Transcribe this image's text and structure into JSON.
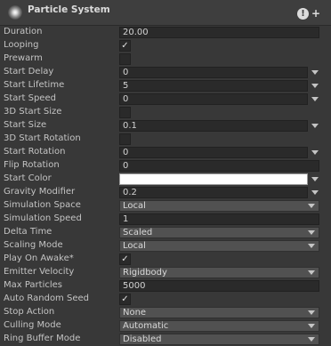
{
  "header": {
    "title": "Particle System",
    "icon": "particle-system-icon",
    "help_glyph": "!",
    "add_glyph": "+"
  },
  "rows": {
    "duration": {
      "label": "Duration",
      "value": "20.00"
    },
    "looping": {
      "label": "Looping",
      "checked": true
    },
    "prewarm": {
      "label": "Prewarm",
      "checked": false
    },
    "start_delay": {
      "label": "Start Delay",
      "value": "0"
    },
    "start_lifetime": {
      "label": "Start Lifetime",
      "value": "5"
    },
    "start_speed": {
      "label": "Start Speed",
      "value": "0"
    },
    "start_size_3d": {
      "label": "3D Start Size",
      "checked": false
    },
    "start_size": {
      "label": "Start Size",
      "value": "0.1"
    },
    "start_rotation_3d": {
      "label": "3D Start Rotation",
      "checked": false
    },
    "start_rotation": {
      "label": "Start Rotation",
      "value": "0"
    },
    "flip_rotation": {
      "label": "Flip Rotation",
      "value": "0"
    },
    "start_color": {
      "label": "Start Color",
      "value": "#ffffff"
    },
    "gravity_modifier": {
      "label": "Gravity Modifier",
      "value": "0.2"
    },
    "simulation_space": {
      "label": "Simulation Space",
      "value": "Local"
    },
    "simulation_speed": {
      "label": "Simulation Speed",
      "value": "1"
    },
    "delta_time": {
      "label": "Delta Time",
      "value": "Scaled"
    },
    "scaling_mode": {
      "label": "Scaling Mode",
      "value": "Local"
    },
    "play_on_awake": {
      "label": "Play On Awake*",
      "checked": true
    },
    "emitter_velocity": {
      "label": "Emitter Velocity",
      "value": "Rigidbody"
    },
    "max_particles": {
      "label": "Max Particles",
      "value": "5000"
    },
    "auto_random_seed": {
      "label": "Auto Random Seed",
      "checked": true
    },
    "stop_action": {
      "label": "Stop Action",
      "value": "None"
    },
    "culling_mode": {
      "label": "Culling Mode",
      "value": "Automatic"
    },
    "ring_buffer_mode": {
      "label": "Ring Buffer Mode",
      "value": "Disabled"
    }
  },
  "check_glyph": "✓",
  "colors": {
    "background": "#383838",
    "field": "#2a2a2a",
    "dropdown": "#515151",
    "text": "#c4c4c4"
  }
}
